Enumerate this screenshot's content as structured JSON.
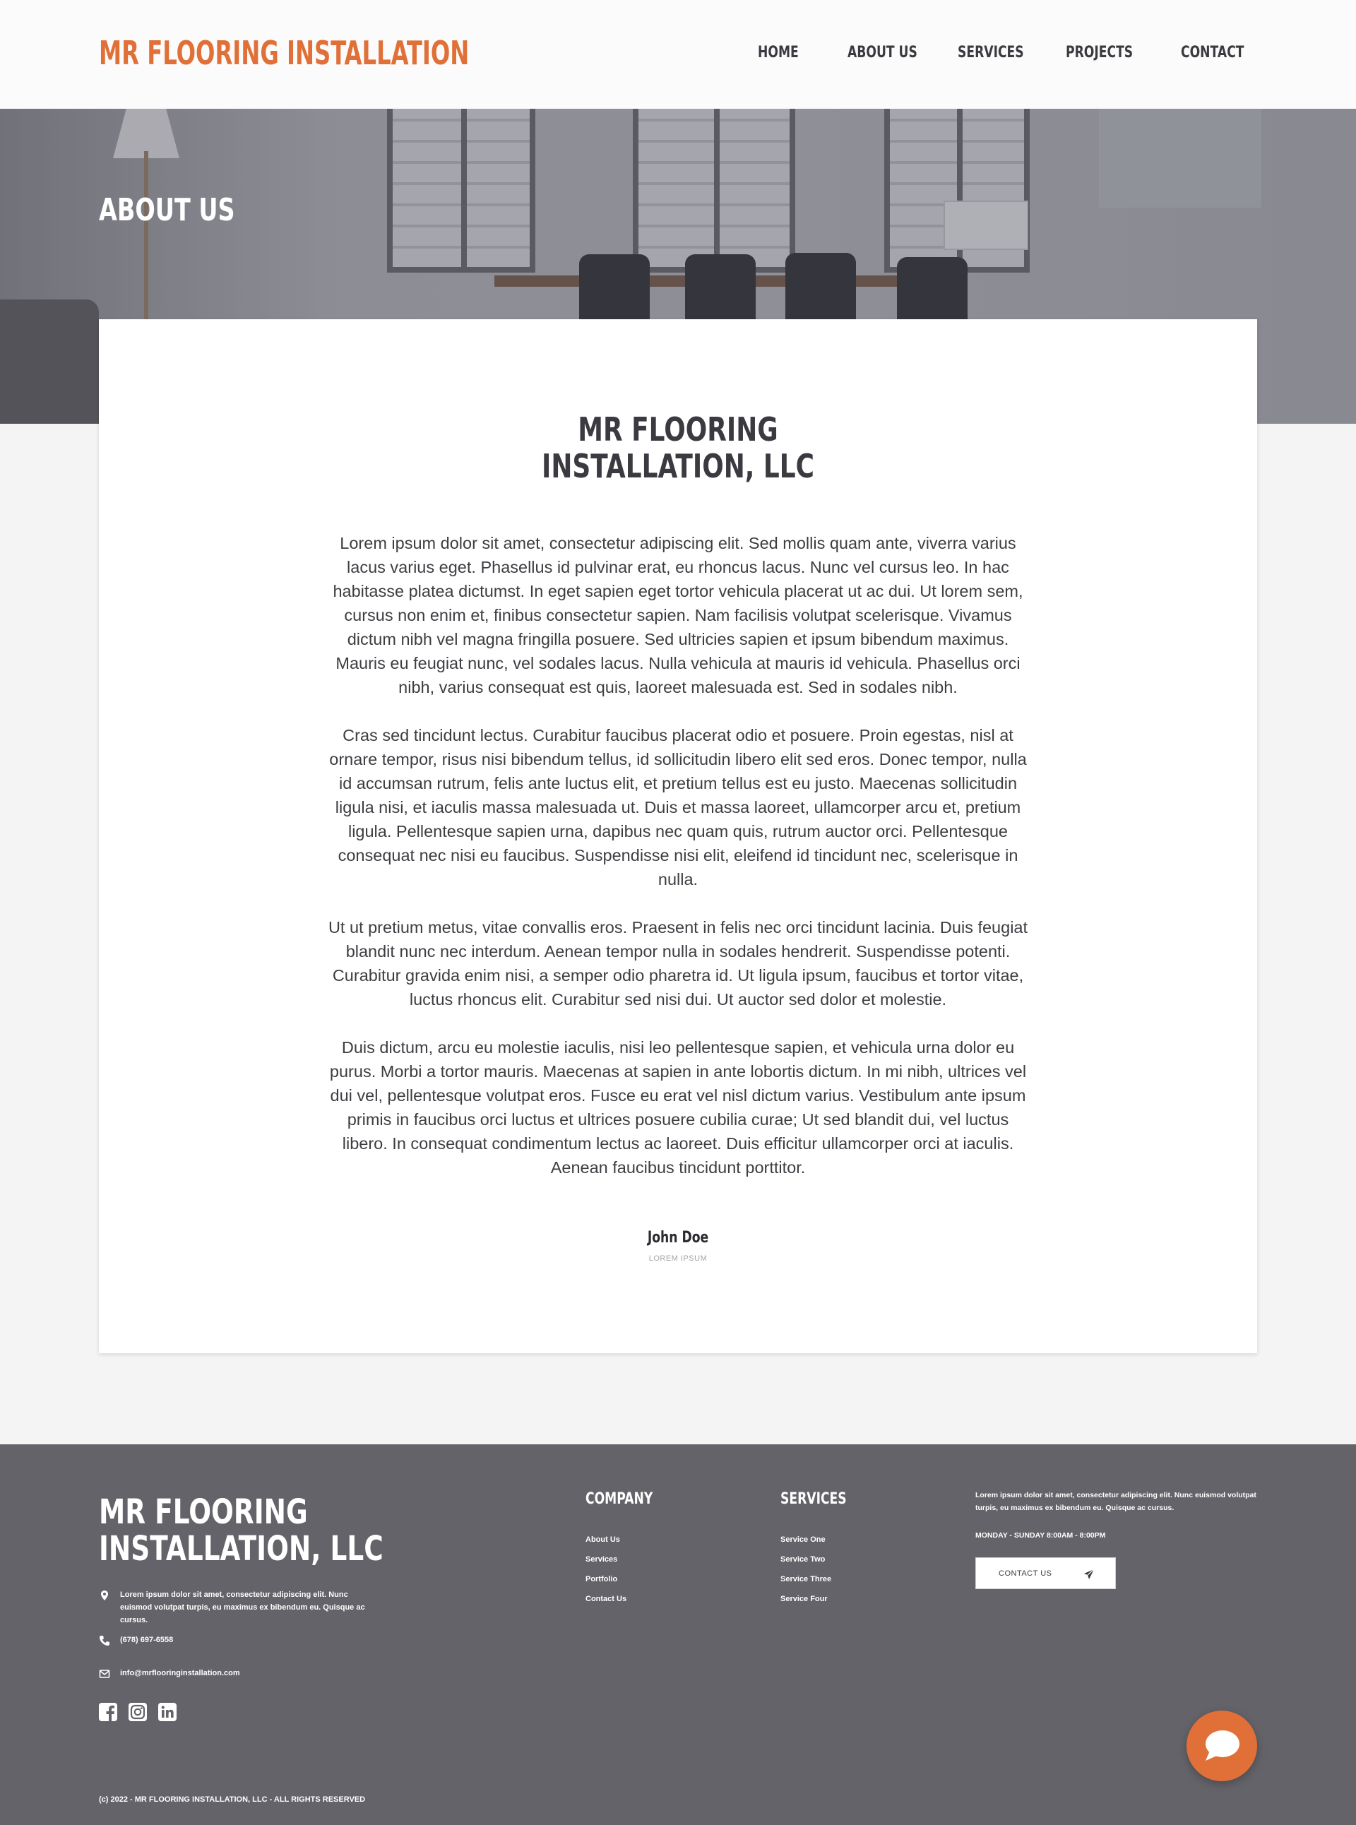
{
  "header": {
    "logo": "MR FLOORING INSTALLATION",
    "nav": [
      {
        "label": "HOME"
      },
      {
        "label": "ABOUT US"
      },
      {
        "label": "SERVICES"
      },
      {
        "label": "PROJECTS"
      },
      {
        "label": "CONTACT"
      }
    ]
  },
  "hero": {
    "title": "ABOUT US"
  },
  "about": {
    "title_line1": "MR FLOORING",
    "title_line2": "INSTALLATION, LLC",
    "paragraphs": [
      "Lorem ipsum dolor sit amet, consectetur adipiscing elit. Sed mollis quam ante, viverra varius lacus varius eget. Phasellus id pulvinar erat, eu rhoncus lacus. Nunc vel cursus leo. In hac habitasse platea dictumst. In eget sapien eget tortor vehicula placerat ut ac dui. Ut lorem sem, cursus non enim et, finibus consectetur sapien. Nam facilisis volutpat scelerisque. Vivamus dictum nibh vel magna fringilla posuere. Sed ultricies sapien et ipsum bibendum maximus. Mauris eu feugiat nunc, vel sodales lacus. Nulla vehicula at mauris id vehicula. Phasellus orci nibh, varius consequat est quis, laoreet malesuada est. Sed in sodales nibh.",
      "Cras sed tincidunt lectus. Curabitur faucibus placerat odio et posuere. Proin egestas, nisl at ornare tempor, risus nisi bibendum tellus, id sollicitudin libero elit sed eros. Donec tempor, nulla id accumsan rutrum, felis ante luctus elit, et pretium tellus est eu justo. Maecenas sollicitudin ligula nisi, et iaculis massa malesuada ut. Duis et massa laoreet, ullamcorper arcu et, pretium ligula. Pellentesque sapien urna, dapibus nec quam quis, rutrum auctor orci. Pellentesque consequat nec nisi eu faucibus. Suspendisse nisi elit, eleifend id tincidunt nec, scelerisque in nulla.",
      "Ut ut pretium metus, vitae convallis eros. Praesent in felis nec orci tincidunt lacinia. Duis feugiat blandit nunc nec interdum. Aenean tempor nulla in sodales hendrerit. Suspendisse potenti. Curabitur gravida enim nisi, a semper odio pharetra id. Ut ligula ipsum, faucibus et tortor vitae, luctus rhoncus elit. Curabitur sed nisi dui. Ut auctor sed dolor et molestie.",
      "Duis dictum, arcu eu molestie iaculis, nisi leo pellentesque sapien, et vehicula urna dolor eu purus. Morbi a tortor mauris. Maecenas at sapien in ante lobortis dictum. In mi nibh, ultrices vel dui vel, pellentesque volutpat eros. Fusce eu erat vel nisl dictum varius. Vestibulum ante ipsum primis in faucibus orci luctus et ultrices posuere cubilia curae; Ut sed blandit dui, vel luctus libero. In consequat condimentum lectus ac laoreet. Duis efficitur ullamcorper orci at iaculis. Aenean faucibus tincidunt porttitor."
    ],
    "signature_name": "John Doe",
    "signature_role": "LOREM IPSUM"
  },
  "footer": {
    "logo_line1": "MR FLOORING",
    "logo_line2": "INSTALLATION, LLC",
    "address": "Lorem ipsum dolor sit amet, consectetur adipiscing elit. Nunc euismod volutpat turpis, eu maximus ex bibendum eu. Quisque ac cursus.",
    "phone": "(678) 697-6558",
    "email": "info@mrflooringinstallation.com",
    "socials": [
      {
        "icon": "facebook-icon"
      },
      {
        "icon": "instagram-icon"
      },
      {
        "icon": "linkedin-icon"
      }
    ],
    "company": {
      "title": "COMPANY",
      "links": [
        "About Us",
        "Services",
        "Portfolio",
        "Contact Us"
      ]
    },
    "services": {
      "title": "SERVICES",
      "links": [
        "Service One",
        "Service Two",
        "Service Three",
        "Service Four"
      ]
    },
    "description": "Lorem ipsum dolor sit amet, consectetur adipiscing elit. Nunc euismod volutpat turpis, eu maximus ex bibendum eu. Quisque ac cursus.",
    "hours": "MONDAY - SUNDAY 8:00AM - 8:00PM",
    "contact_button": "CONTACT US",
    "copyright": "(c) 2022 - MR FLOORING INSTALLATION, LLC - ALL RIGHTS RESERVED"
  },
  "chat": {
    "icon": "chat-bubble-icon"
  },
  "colors": {
    "accent": "#e07038",
    "footer_bg": "#636369",
    "page_bg": "#f4f4f4",
    "text_dark": "#3a3a40"
  }
}
